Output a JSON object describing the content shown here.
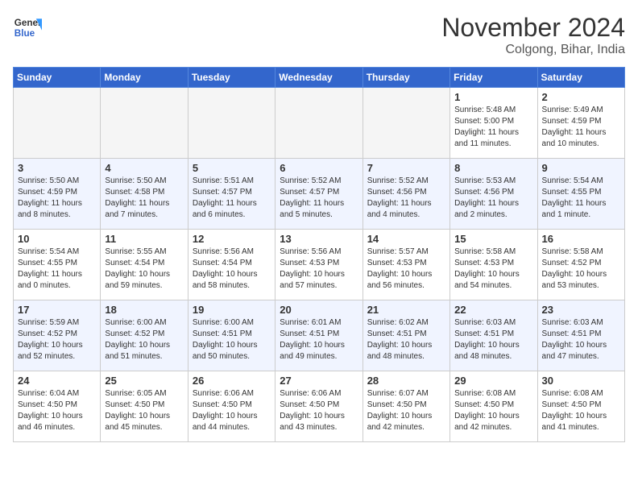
{
  "header": {
    "logo_general": "General",
    "logo_blue": "Blue",
    "month_title": "November 2024",
    "location": "Colgong, Bihar, India"
  },
  "calendar": {
    "days_of_week": [
      "Sunday",
      "Monday",
      "Tuesday",
      "Wednesday",
      "Thursday",
      "Friday",
      "Saturday"
    ],
    "weeks": [
      [
        {
          "day": "",
          "info": ""
        },
        {
          "day": "",
          "info": ""
        },
        {
          "day": "",
          "info": ""
        },
        {
          "day": "",
          "info": ""
        },
        {
          "day": "",
          "info": ""
        },
        {
          "day": "1",
          "info": "Sunrise: 5:48 AM\nSunset: 5:00 PM\nDaylight: 11 hours and 11 minutes."
        },
        {
          "day": "2",
          "info": "Sunrise: 5:49 AM\nSunset: 4:59 PM\nDaylight: 11 hours and 10 minutes."
        }
      ],
      [
        {
          "day": "3",
          "info": "Sunrise: 5:50 AM\nSunset: 4:59 PM\nDaylight: 11 hours and 8 minutes."
        },
        {
          "day": "4",
          "info": "Sunrise: 5:50 AM\nSunset: 4:58 PM\nDaylight: 11 hours and 7 minutes."
        },
        {
          "day": "5",
          "info": "Sunrise: 5:51 AM\nSunset: 4:57 PM\nDaylight: 11 hours and 6 minutes."
        },
        {
          "day": "6",
          "info": "Sunrise: 5:52 AM\nSunset: 4:57 PM\nDaylight: 11 hours and 5 minutes."
        },
        {
          "day": "7",
          "info": "Sunrise: 5:52 AM\nSunset: 4:56 PM\nDaylight: 11 hours and 4 minutes."
        },
        {
          "day": "8",
          "info": "Sunrise: 5:53 AM\nSunset: 4:56 PM\nDaylight: 11 hours and 2 minutes."
        },
        {
          "day": "9",
          "info": "Sunrise: 5:54 AM\nSunset: 4:55 PM\nDaylight: 11 hours and 1 minute."
        }
      ],
      [
        {
          "day": "10",
          "info": "Sunrise: 5:54 AM\nSunset: 4:55 PM\nDaylight: 11 hours and 0 minutes."
        },
        {
          "day": "11",
          "info": "Sunrise: 5:55 AM\nSunset: 4:54 PM\nDaylight: 10 hours and 59 minutes."
        },
        {
          "day": "12",
          "info": "Sunrise: 5:56 AM\nSunset: 4:54 PM\nDaylight: 10 hours and 58 minutes."
        },
        {
          "day": "13",
          "info": "Sunrise: 5:56 AM\nSunset: 4:53 PM\nDaylight: 10 hours and 57 minutes."
        },
        {
          "day": "14",
          "info": "Sunrise: 5:57 AM\nSunset: 4:53 PM\nDaylight: 10 hours and 56 minutes."
        },
        {
          "day": "15",
          "info": "Sunrise: 5:58 AM\nSunset: 4:53 PM\nDaylight: 10 hours and 54 minutes."
        },
        {
          "day": "16",
          "info": "Sunrise: 5:58 AM\nSunset: 4:52 PM\nDaylight: 10 hours and 53 minutes."
        }
      ],
      [
        {
          "day": "17",
          "info": "Sunrise: 5:59 AM\nSunset: 4:52 PM\nDaylight: 10 hours and 52 minutes."
        },
        {
          "day": "18",
          "info": "Sunrise: 6:00 AM\nSunset: 4:52 PM\nDaylight: 10 hours and 51 minutes."
        },
        {
          "day": "19",
          "info": "Sunrise: 6:00 AM\nSunset: 4:51 PM\nDaylight: 10 hours and 50 minutes."
        },
        {
          "day": "20",
          "info": "Sunrise: 6:01 AM\nSunset: 4:51 PM\nDaylight: 10 hours and 49 minutes."
        },
        {
          "day": "21",
          "info": "Sunrise: 6:02 AM\nSunset: 4:51 PM\nDaylight: 10 hours and 48 minutes."
        },
        {
          "day": "22",
          "info": "Sunrise: 6:03 AM\nSunset: 4:51 PM\nDaylight: 10 hours and 48 minutes."
        },
        {
          "day": "23",
          "info": "Sunrise: 6:03 AM\nSunset: 4:51 PM\nDaylight: 10 hours and 47 minutes."
        }
      ],
      [
        {
          "day": "24",
          "info": "Sunrise: 6:04 AM\nSunset: 4:50 PM\nDaylight: 10 hours and 46 minutes."
        },
        {
          "day": "25",
          "info": "Sunrise: 6:05 AM\nSunset: 4:50 PM\nDaylight: 10 hours and 45 minutes."
        },
        {
          "day": "26",
          "info": "Sunrise: 6:06 AM\nSunset: 4:50 PM\nDaylight: 10 hours and 44 minutes."
        },
        {
          "day": "27",
          "info": "Sunrise: 6:06 AM\nSunset: 4:50 PM\nDaylight: 10 hours and 43 minutes."
        },
        {
          "day": "28",
          "info": "Sunrise: 6:07 AM\nSunset: 4:50 PM\nDaylight: 10 hours and 42 minutes."
        },
        {
          "day": "29",
          "info": "Sunrise: 6:08 AM\nSunset: 4:50 PM\nDaylight: 10 hours and 42 minutes."
        },
        {
          "day": "30",
          "info": "Sunrise: 6:08 AM\nSunset: 4:50 PM\nDaylight: 10 hours and 41 minutes."
        }
      ]
    ]
  }
}
